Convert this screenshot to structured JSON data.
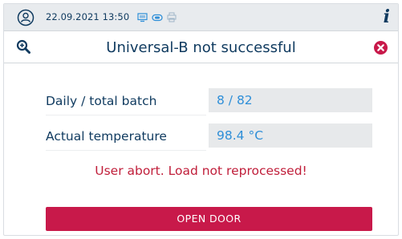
{
  "statusbar": {
    "datetime": "22.09.2021 13:50",
    "icons": [
      "user-icon",
      "monitor-icon",
      "link-icon",
      "printer-icon",
      "info-icon"
    ],
    "info_label": "i"
  },
  "header": {
    "title": "Universal-B not successful",
    "icons": [
      "zoom-in-icon",
      "close-icon"
    ]
  },
  "fields": [
    {
      "label": "Daily / total batch",
      "value": "8 / 82"
    },
    {
      "label": "Actual temperature",
      "value": "98.4 °C"
    }
  ],
  "message": "User abort. Load not reprocessed!",
  "actions": {
    "open_door_label": "OPEN DOOR"
  },
  "colors": {
    "primary_text": "#0f3a5f",
    "value_text": "#2f8fd8",
    "error": "#c01e3a",
    "button": "#c8194a",
    "statusbar_bg": "#e8ebee",
    "field_bg": "#e7e9eb"
  }
}
